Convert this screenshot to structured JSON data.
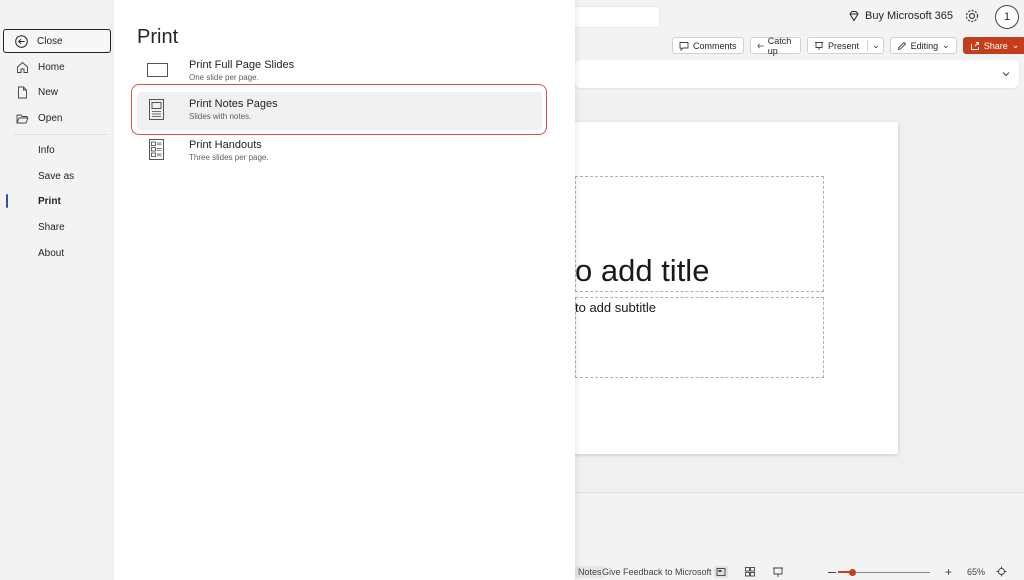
{
  "header": {
    "buy_label": "Buy Microsoft 365",
    "avatar_initial": "1"
  },
  "commands": {
    "comments": "Comments",
    "catch_up": "Catch up",
    "present": "Present",
    "editing": "Editing",
    "share": "Share"
  },
  "slide": {
    "title_placeholder": "o add title",
    "subtitle_placeholder": "to add subtitle"
  },
  "status": {
    "notes": "Notes",
    "feedback": "Give Feedback to Microsoft",
    "zoom": "65%",
    "zoom_fraction": 0.15
  },
  "nav": {
    "close": "Close",
    "home": "Home",
    "new": "New",
    "open": "Open",
    "info": "Info",
    "save_as": "Save as",
    "print": "Print",
    "share": "Share",
    "about": "About"
  },
  "print_panel": {
    "title": "Print",
    "options": [
      {
        "title": "Print Full Page Slides",
        "desc": "One slide per page."
      },
      {
        "title": "Print Notes Pages",
        "desc": "Slides with notes."
      },
      {
        "title": "Print Handouts",
        "desc": "Three slides per page."
      }
    ]
  },
  "colors": {
    "accent": "#c43e1c",
    "nav_active": "#2b579a",
    "highlight": "#d9534f"
  }
}
